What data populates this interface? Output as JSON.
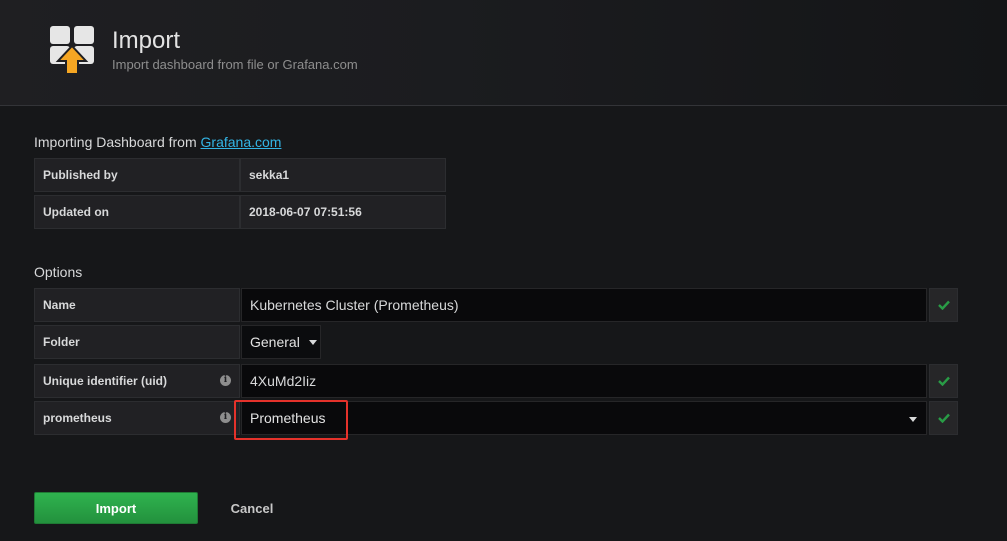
{
  "header": {
    "title": "Import",
    "subtitle": "Import dashboard from file or Grafana.com",
    "icon": "import-dashboard-icon"
  },
  "source": {
    "prefix": "Importing Dashboard from ",
    "link_text": "Grafana.com",
    "rows": [
      {
        "label": "Published by",
        "value": "sekka1"
      },
      {
        "label": "Updated on",
        "value": "2018-06-07 07:51:56"
      }
    ]
  },
  "options": {
    "title": "Options",
    "name": {
      "label": "Name",
      "value": "Kubernetes Cluster (Prometheus)",
      "valid": true
    },
    "folder": {
      "label": "Folder",
      "value": "General"
    },
    "uid": {
      "label": "Unique identifier (uid)",
      "value": "4XuMd2Iiz",
      "valid": true
    },
    "prometheus": {
      "label": "prometheus",
      "value": "Prometheus",
      "valid": true
    }
  },
  "actions": {
    "import_label": "Import",
    "cancel_label": "Cancel"
  },
  "colors": {
    "accent_link": "#33b5e5",
    "success": "#299c46",
    "highlight": "#e5322b"
  }
}
